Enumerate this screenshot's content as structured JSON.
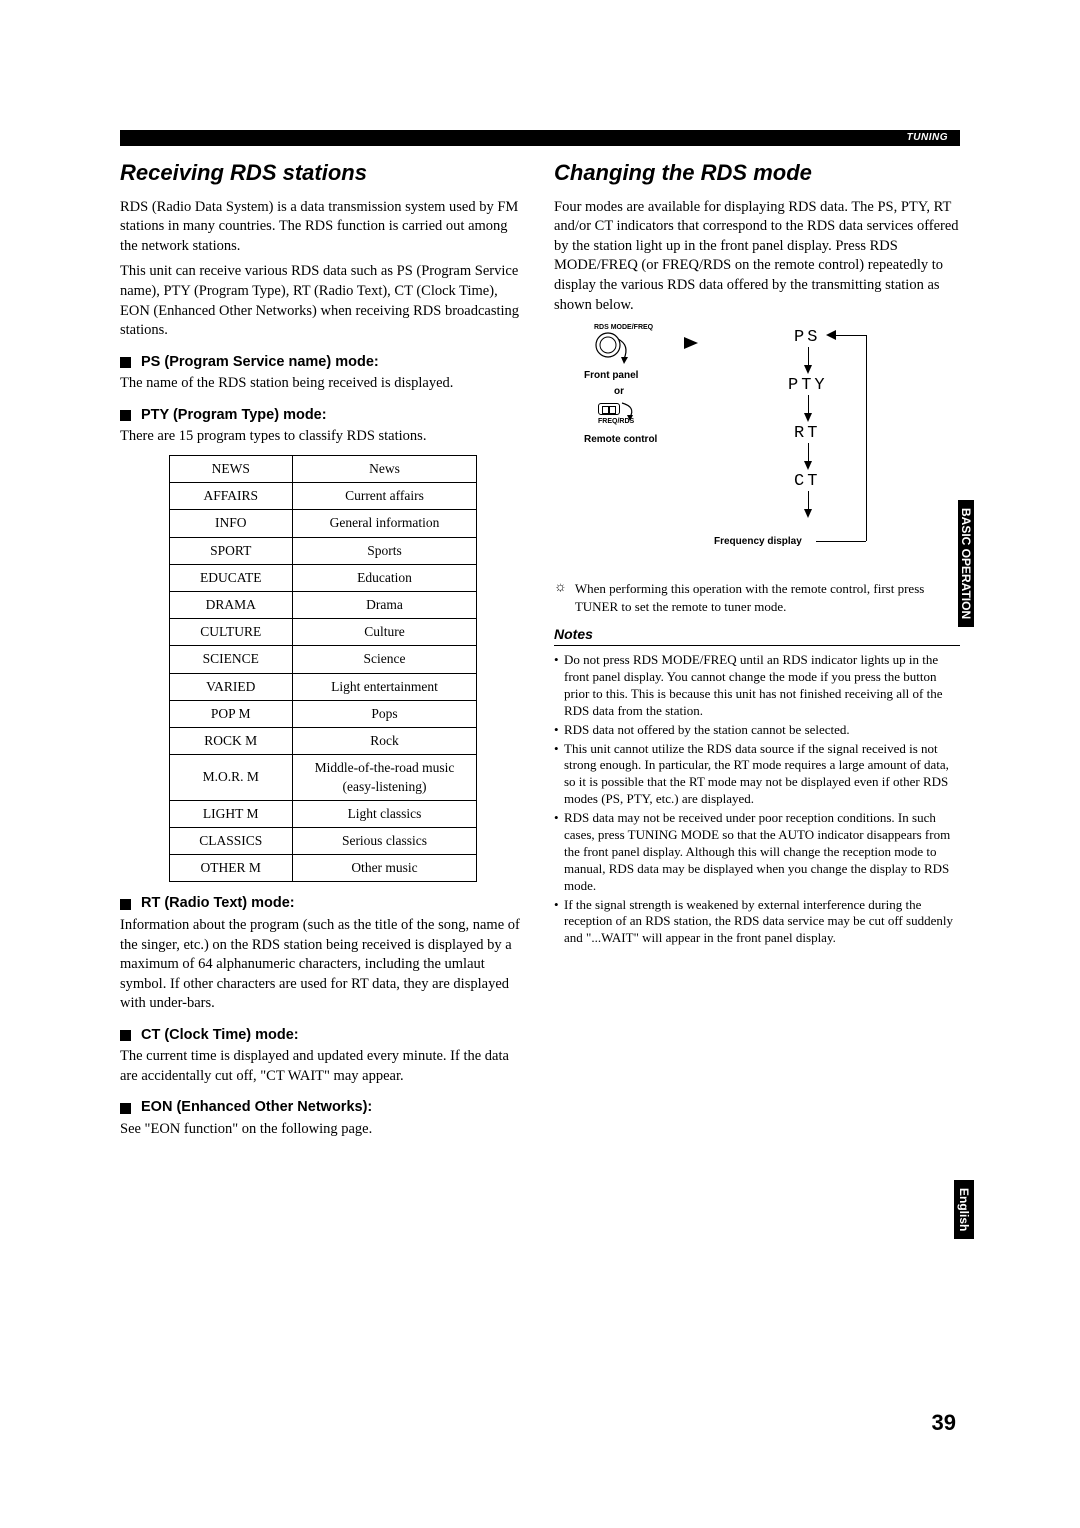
{
  "topbar_label": "TUNING",
  "page_number": "39",
  "side_tabs": {
    "basic": "BASIC OPERATION",
    "english": "English"
  },
  "left": {
    "title": "Receiving RDS stations",
    "intro1": "RDS (Radio Data System) is a data transmission system used by FM stations in many countries. The RDS function is carried out among the network stations.",
    "intro2": "This unit can receive various RDS data such as PS (Program Service name), PTY (Program Type), RT (Radio Text), CT (Clock Time), EON (Enhanced Other Networks) when receiving RDS broadcasting stations.",
    "ps_head": "PS (Program Service name) mode:",
    "ps_body": "The name of the RDS station being received is displayed.",
    "pty_head": "PTY (Program Type) mode:",
    "pty_body": "There are 15 program types to classify RDS stations.",
    "pty_table": [
      [
        "NEWS",
        "News"
      ],
      [
        "AFFAIRS",
        "Current affairs"
      ],
      [
        "INFO",
        "General information"
      ],
      [
        "SPORT",
        "Sports"
      ],
      [
        "EDUCATE",
        "Education"
      ],
      [
        "DRAMA",
        "Drama"
      ],
      [
        "CULTURE",
        "Culture"
      ],
      [
        "SCIENCE",
        "Science"
      ],
      [
        "VARIED",
        "Light entertainment"
      ],
      [
        "POP M",
        "Pops"
      ],
      [
        "ROCK M",
        "Rock"
      ],
      [
        "M.O.R. M",
        "Middle-of-the-road music (easy-listening)"
      ],
      [
        "LIGHT M",
        "Light classics"
      ],
      [
        "CLASSICS",
        "Serious classics"
      ],
      [
        "OTHER M",
        "Other music"
      ]
    ],
    "rt_head": "RT (Radio Text) mode:",
    "rt_body": "Information about the program (such as the title of the song, name of the singer, etc.) on the RDS station being received is displayed by a maximum of 64 alphanumeric characters, including the umlaut symbol. If other characters are used for RT data, they are displayed with under-bars.",
    "ct_head": "CT (Clock Time) mode:",
    "ct_body": "The current time is displayed and updated every minute. If the data are accidentally cut off, \"CT WAIT\" may appear.",
    "eon_head": "EON (Enhanced Other Networks):",
    "eon_body": "See \"EON function\" on the following page."
  },
  "right": {
    "title": "Changing the RDS mode",
    "intro": "Four modes are available for displaying RDS data. The PS, PTY, RT and/or CT indicators that correspond to the RDS data services offered by the station light up in the front panel display. Press RDS MODE/FREQ (or FREQ/RDS on the remote control) repeatedly to display the various RDS data offered by the transmitting station as shown below.",
    "diagram": {
      "rds_mode_freq": "RDS MODE/FREQ",
      "front_panel": "Front panel",
      "or": "or",
      "freq_rds": "FREQ/RDS",
      "remote_control": "Remote control",
      "ps": "PS",
      "pty": "PTY",
      "rt": "RT",
      "ct": "CT",
      "freq_display": "Frequency display"
    },
    "tip": "When performing this operation with the remote control, first press TUNER to set the remote to tuner mode.",
    "notes_head": "Notes",
    "notes": [
      "Do not press RDS MODE/FREQ until an RDS indicator lights up in the front panel display. You cannot change the mode if you press the button prior to this. This is because this unit has not finished receiving all of the RDS data from the station.",
      "RDS data not offered by the station cannot be selected.",
      "This unit cannot utilize the RDS data source if the signal received is not strong enough. In particular, the RT mode requires a large amount of data, so it is possible that the RT mode may not be displayed even if other RDS modes (PS, PTY, etc.) are displayed.",
      "RDS data may not be received under poor reception conditions. In such cases, press TUNING MODE so that the AUTO indicator disappears from the front panel display. Although this will change the reception mode to manual, RDS data may be displayed when you change the display to RDS mode.",
      "If the signal strength is weakened by external interference during the reception of an RDS station, the RDS data service may be cut off suddenly and \"...WAIT\" will appear in the front panel display."
    ]
  }
}
